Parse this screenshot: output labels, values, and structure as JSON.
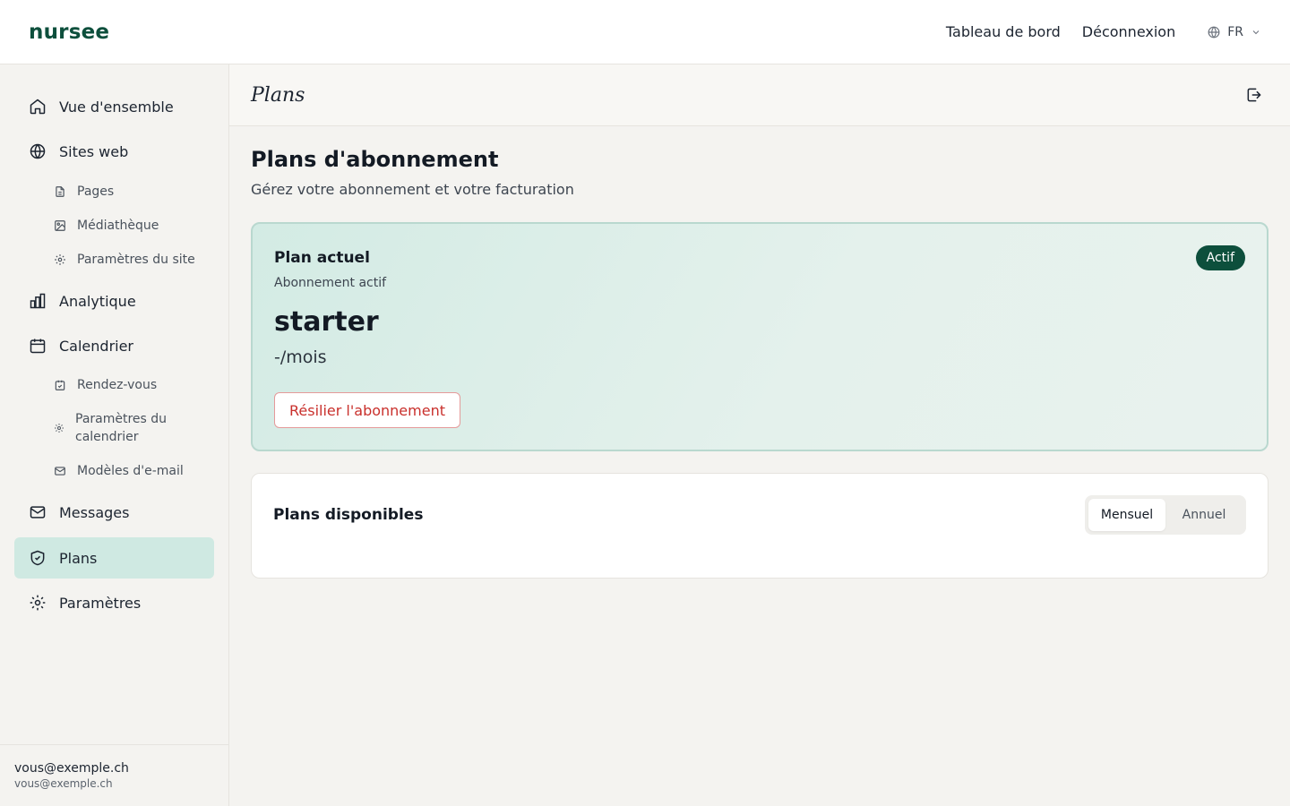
{
  "app": {
    "brand": "nursee"
  },
  "topnav": {
    "dashboard": "Tableau de bord",
    "logout": "Déconnexion",
    "language": "FR"
  },
  "sidebar": {
    "overview": "Vue d'ensemble",
    "websites": "Sites web",
    "pages": "Pages",
    "media": "Médiathèque",
    "site_settings": "Paramètres du site",
    "analytics": "Analytique",
    "calendar": "Calendrier",
    "appointments": "Rendez-vous",
    "calendar_settings": "Paramètres du calendrier",
    "email_templates": "Modèles d'e-mail",
    "messages": "Messages",
    "plans": "Plans",
    "settings": "Paramètres"
  },
  "user": {
    "name": "vous@exemple.ch",
    "email": "vous@exemple.ch"
  },
  "page": {
    "header_title": "Plans",
    "heading": "Plans d'abonnement",
    "subheading": "Gérez votre abonnement et votre facturation"
  },
  "current_plan": {
    "title": "Plan actuel",
    "subtitle": "Abonnement actif",
    "badge": "Actif",
    "plan_name": "starter",
    "price": "-/mois",
    "cancel_label": "Résilier l'abonnement"
  },
  "available_plans": {
    "title": "Plans disponibles",
    "billing_options": [
      "Mensuel",
      "Annuel"
    ],
    "selected": "Mensuel"
  },
  "colors": {
    "brand": "#0d4f3c",
    "active_nav": "#cfe9e2",
    "danger": "#c9302c"
  }
}
